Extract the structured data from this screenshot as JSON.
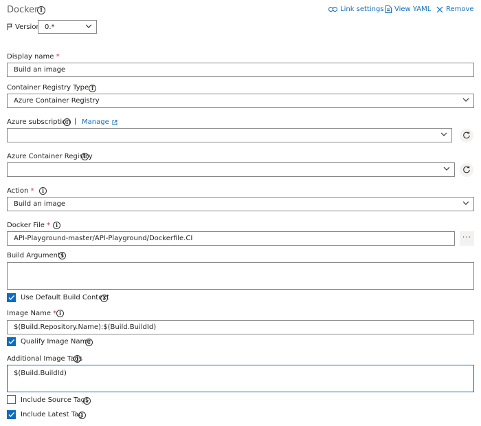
{
  "header": {
    "title": "Docker",
    "actions": {
      "link_settings": "Link settings",
      "view_yaml": "View YAML",
      "remove": "Remove"
    }
  },
  "version": {
    "label": "Version",
    "value": "0.*"
  },
  "fields": {
    "display_name": {
      "label": "Display name",
      "value": "Build an image"
    },
    "registry_type": {
      "label": "Container Registry Type",
      "value": "Azure Container Registry"
    },
    "azure_subscription": {
      "label": "Azure subscription",
      "manage": "Manage",
      "value": ""
    },
    "azure_registry": {
      "label": "Azure Container Registry",
      "value": ""
    },
    "action": {
      "label": "Action",
      "value": "Build an image"
    },
    "docker_file": {
      "label": "Docker File",
      "value": "API-Playground-master/API-Playground/Dockerfile.CI",
      "browse": "···"
    },
    "build_args": {
      "label": "Build Arguments",
      "value": ""
    },
    "image_name": {
      "label": "Image Name",
      "value": "$(Build.Repository.Name):$(Build.BuildId)"
    },
    "additional_tags": {
      "label": "Additional Image Tags",
      "value": "$(Build.BuildId)"
    }
  },
  "checkboxes": {
    "default_context": {
      "label": "Use Default Build Context",
      "checked": true
    },
    "qualify_image": {
      "label": "Qualify Image Name",
      "checked": true
    },
    "source_tags": {
      "label": "Include Source Tags",
      "checked": false
    },
    "latest_tag": {
      "label": "Include Latest Tag",
      "checked": true
    }
  },
  "required_marker": "*",
  "info_glyph": "i",
  "colors": {
    "accent": "#0f6cbd",
    "required": "#c4314b",
    "border": "#8a8886"
  }
}
